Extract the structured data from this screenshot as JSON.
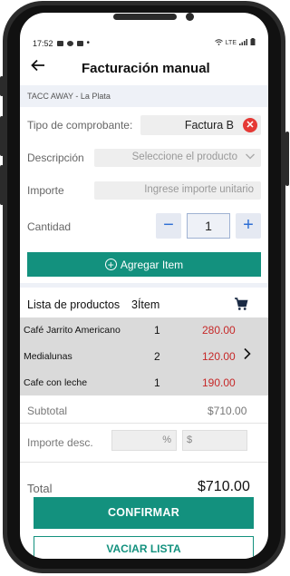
{
  "status_bar": {
    "time": "17:52",
    "right": "LTE"
  },
  "appbar": {
    "back_icon": "arrow-left-icon",
    "title": "Facturación manual"
  },
  "store": {
    "name": "TACC AWAY - La Plata"
  },
  "form": {
    "tipo_label": "Tipo de comprobante:",
    "tipo_value": "Factura B",
    "descripcion_label": "Descripción",
    "descripcion_placeholder": "Seleccione el producto",
    "importe_label": "Importe",
    "importe_placeholder": "Ingrese importe unitario",
    "cantidad_label": "Cantidad",
    "cantidad_value": "1",
    "minus": "−",
    "plus": "+",
    "agregar_label": "Agregar Item"
  },
  "products": {
    "header": "Lista de productos",
    "count": "3Ítem",
    "items": [
      {
        "name": "Café Jarrito Americano",
        "qty": "1",
        "price": "280.00"
      },
      {
        "name": "Medialunas",
        "qty": "2",
        "price": "120.00"
      },
      {
        "name": "Cafe con leche",
        "qty": "1",
        "price": "190.00"
      }
    ]
  },
  "summary": {
    "subtotal_label": "Subtotal",
    "subtotal_value": "$710.00",
    "desc_label": "Importe desc.",
    "percent_symbol": "%",
    "dollar_symbol": "$",
    "total_label": "Total",
    "total_value": "$710.00"
  },
  "actions": {
    "confirm": "CONFIRMAR",
    "clear": "VACIAR LISTA"
  },
  "colors": {
    "primary": "#13917e",
    "price": "#c62828",
    "accent_blue": "#2f6fd4",
    "danger": "#e53935"
  }
}
